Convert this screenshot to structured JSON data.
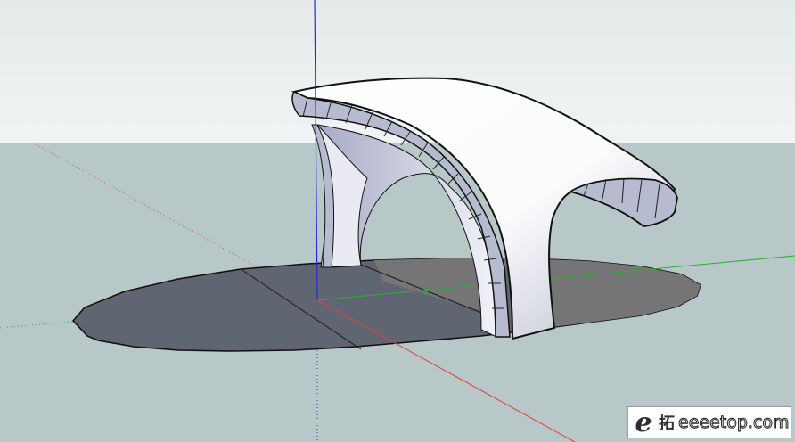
{
  "scene": {
    "sky_color": "#e9eeee",
    "ground_color": "#b8c8c8",
    "shadow_color": "#5e6470",
    "surface_color": "#ffffff",
    "section_color": "#b9bccd",
    "axis_colors": {
      "red": "#d93030",
      "green": "#2faa2f",
      "blue": "#2b2bd0"
    }
  },
  "watermark": {
    "logo": "e",
    "cn": "拓",
    "text": "eeeetop.com"
  }
}
